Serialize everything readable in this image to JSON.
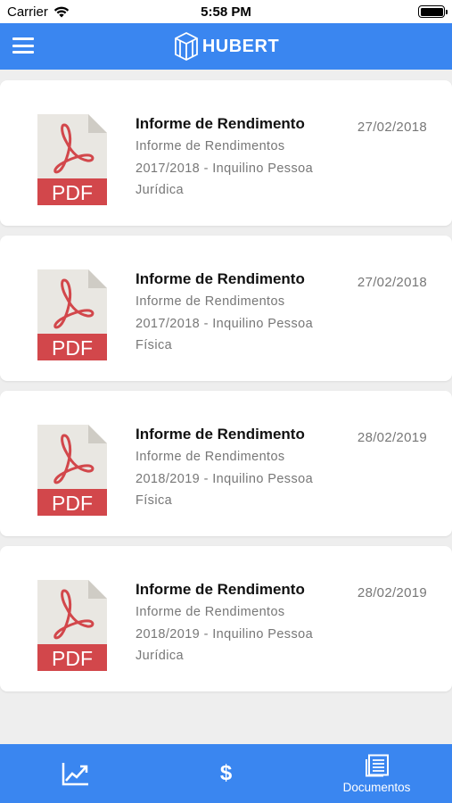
{
  "status_bar": {
    "carrier": "Carrier",
    "time": "5:58 PM"
  },
  "app_bar": {
    "logo_text": "HUBERT"
  },
  "documents": [
    {
      "badge": "PDF",
      "title": "Informe de Rendimento",
      "description": "Informe de Rendimentos 2017/2018 - Inquilino Pessoa Jurídica",
      "date": "27/02/2018"
    },
    {
      "badge": "PDF",
      "title": "Informe de Rendimento",
      "description": "Informe de Rendimentos 2017/2018 - Inquilino Pessoa Física",
      "date": "27/02/2018"
    },
    {
      "badge": "PDF",
      "title": "Informe de Rendimento",
      "description": "Informe de Rendimentos 2018/2019 - Inquilino Pessoa Física",
      "date": "28/02/2019"
    },
    {
      "badge": "PDF",
      "title": "Informe de Rendimento",
      "description": "Informe de Rendimentos 2018/2019 - Inquilino Pessoa Jurídica",
      "date": "28/02/2019"
    }
  ],
  "tab_bar": {
    "tabs": [
      {
        "icon": "chart-icon",
        "label": ""
      },
      {
        "icon": "dollar-icon",
        "symbol": "$",
        "label": ""
      },
      {
        "icon": "documents-icon",
        "label": "Documentos"
      }
    ]
  },
  "colors": {
    "primary": "#3a86f0",
    "pdf_red": "#d2474b",
    "background": "#eeeeee"
  }
}
